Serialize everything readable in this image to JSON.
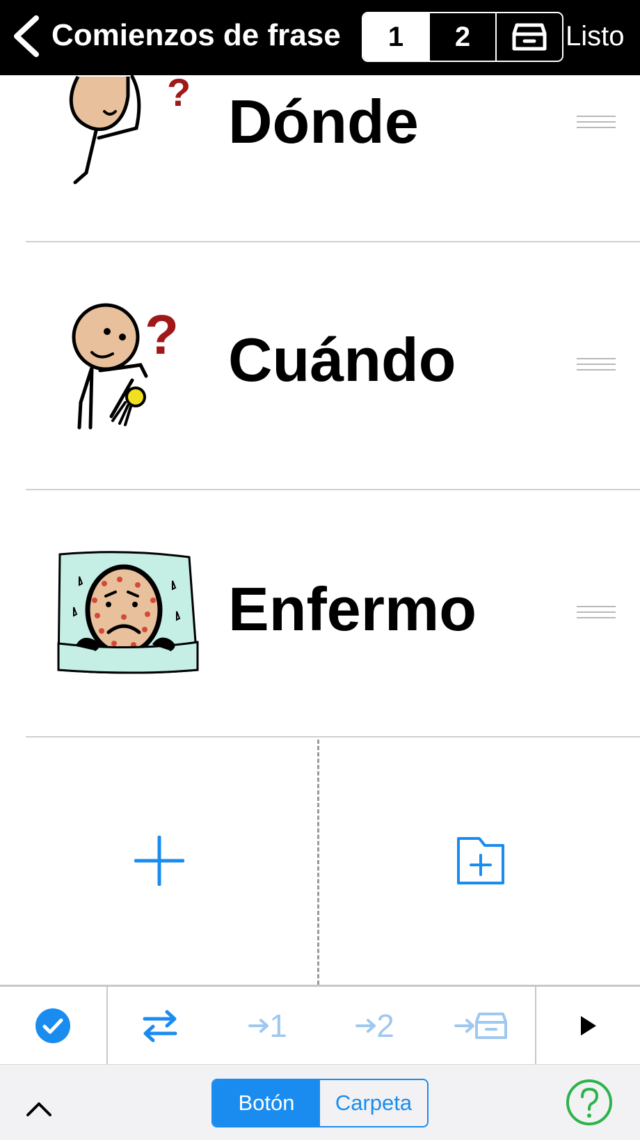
{
  "nav": {
    "back_icon": "chevron-left-icon",
    "title": "Comienzos de frase",
    "segments": [
      "1",
      "2"
    ],
    "segment_archive_icon": "archive-box-icon",
    "selected_segment": "1",
    "done_label": "Listo"
  },
  "list": {
    "items": [
      {
        "label": "Dónde",
        "icon": "person-question-icon",
        "handle_icon": "drag-handle-icon"
      },
      {
        "label": "Cuándo",
        "icon": "person-clock-question-icon",
        "handle_icon": "drag-handle-icon"
      },
      {
        "label": "Enfermo",
        "icon": "sick-person-in-bed-icon",
        "handle_icon": "drag-handle-icon"
      }
    ]
  },
  "add": {
    "add_button_icon": "plus-icon",
    "add_folder_icon": "folder-plus-icon"
  },
  "toolbar": {
    "select_icon": "checkmark-circle-icon",
    "swap_icon": "swap-arrows-icon",
    "move_to_1": "1",
    "move_to_2": "2",
    "move_to_archive_icon": "archive-box-icon",
    "play_icon": "play-icon",
    "colors": {
      "accent": "#1a8cf0",
      "disabled_accent": "#9fc8f0"
    }
  },
  "bottom": {
    "expand_icon": "chevron-up-icon",
    "modes": [
      "Botón",
      "Carpeta"
    ],
    "selected_mode": "Botón",
    "help_icon": "question-circle-icon",
    "help_color": "#2db34a"
  }
}
